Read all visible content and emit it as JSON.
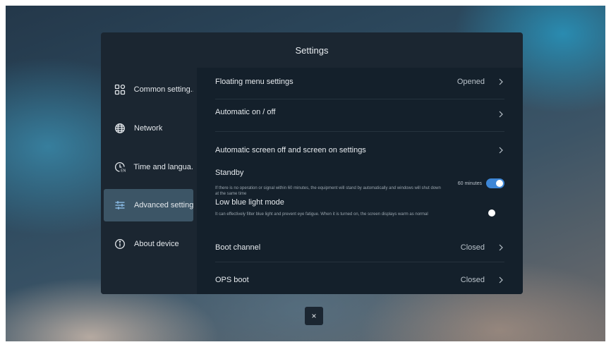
{
  "dialog": {
    "title": "Settings"
  },
  "sidebar": {
    "items": [
      {
        "label": "Common setting..",
        "icon": "grid-icon",
        "active": false
      },
      {
        "label": "Network",
        "icon": "globe-icon",
        "active": false
      },
      {
        "label": "Time and langua..",
        "icon": "clock-language-icon",
        "active": false
      },
      {
        "label": "Advanced setting",
        "icon": "sliders-icon",
        "active": true
      },
      {
        "label": "About device",
        "icon": "info-icon",
        "active": false
      }
    ]
  },
  "settings": {
    "floating_menu": {
      "title": "Floating menu settings",
      "value": "Opened"
    },
    "auto_on_off": {
      "title": "Automatic on / off"
    },
    "auto_screen": {
      "title": "Automatic screen off and screen on settings"
    },
    "standby": {
      "title": "Standby",
      "desc": "If there is no operation or signal within 60 minutes, the equipment will stand by automatically and windows will shut down at the same time",
      "value": "60 minutes",
      "enabled": true
    },
    "low_blue_light": {
      "title": "Low blue light mode",
      "desc": "It can effectively filter blue light and prevent eye fatigue. When it is turned on, the screen displays warm as normal",
      "enabled": false
    },
    "boot_channel": {
      "title": "Boot channel",
      "value": "Closed"
    },
    "ops_boot": {
      "title": "OPS boot",
      "value": "Closed"
    }
  },
  "close_button": {
    "label": "×"
  },
  "colors": {
    "accent": "#3d86d6",
    "panel": "#1b2631",
    "content": "#14202b",
    "active_item": "#3c5566"
  }
}
